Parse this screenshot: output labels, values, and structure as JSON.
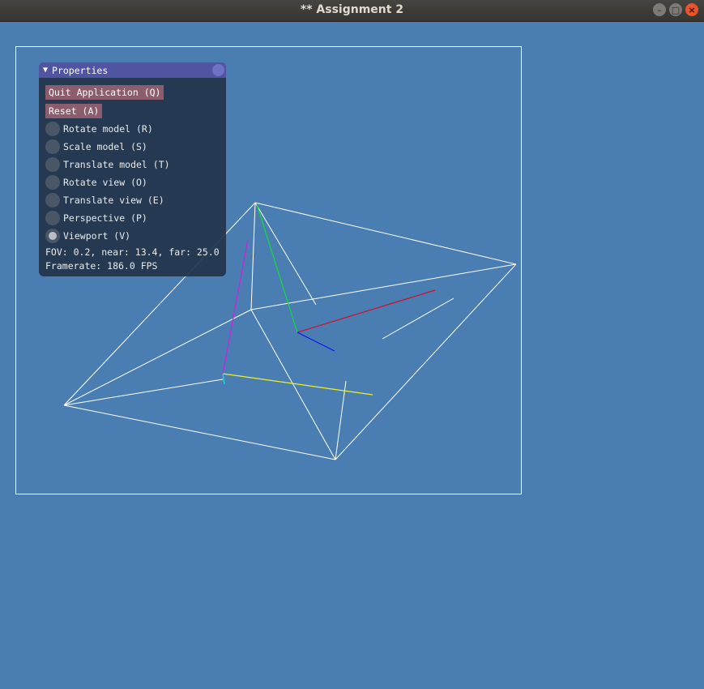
{
  "window": {
    "title": "** Assignment 2"
  },
  "colors": {
    "background": "#4a7eb3",
    "panel_bg": "#22344a",
    "panel_header": "#5155a1",
    "button": "#8b5d6d",
    "wire": "#ffffff",
    "axis_x": "#d0102a",
    "axis_y": "#11dd33",
    "axis_z": "#1010ee",
    "axis_world_x": "#f0f020",
    "axis_world_y": "#cc22dd",
    "axis_world_z": "#22dddd"
  },
  "panel": {
    "title": "Properties",
    "quit_label": "Quit Application (Q)",
    "reset_label": "Reset (A)",
    "modes": [
      {
        "label": "Rotate model (R)",
        "selected": false
      },
      {
        "label": "Scale model (S)",
        "selected": false
      },
      {
        "label": "Translate model (T)",
        "selected": false
      },
      {
        "label": "Rotate view (O)",
        "selected": false
      },
      {
        "label": "Translate view (E)",
        "selected": false
      },
      {
        "label": "Perspective (P)",
        "selected": false
      },
      {
        "label": "Viewport (V)",
        "selected": true
      }
    ],
    "camera_info": "FOV: 0.2, near: 13.4, far: 25.0",
    "framerate": "Framerate: 186.0 FPS"
  }
}
